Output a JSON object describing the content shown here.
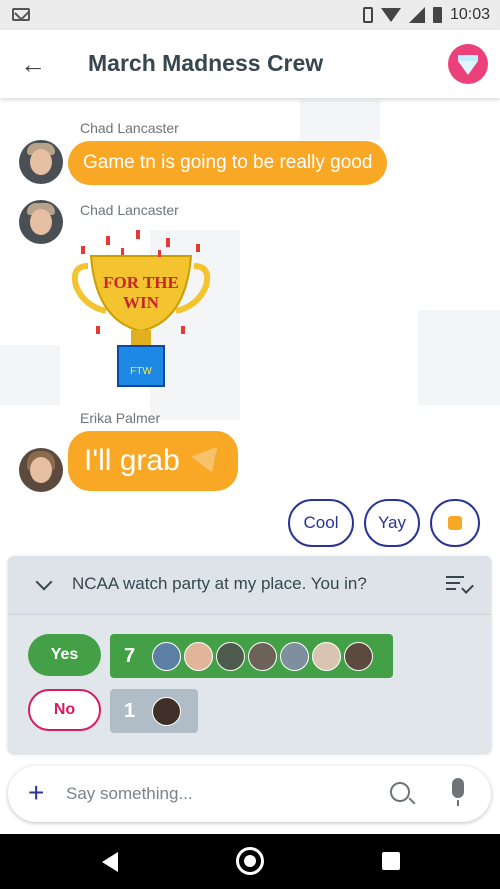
{
  "status_bar": {
    "time": "10:03"
  },
  "app_bar": {
    "title": "March Madness Crew"
  },
  "messages": [
    {
      "sender": "Chad Lancaster",
      "text": "Game tn is going to be really good"
    },
    {
      "sender": "Chad Lancaster",
      "sticker_text": "FOR THE WIN",
      "sticker_base_text": "FTW"
    },
    {
      "sender": "Erika Palmer",
      "text": "I'll grab"
    }
  ],
  "smart_replies": [
    "Cool",
    "Yay"
  ],
  "poll": {
    "question": "NCAA watch party at my place. You in?",
    "options": [
      {
        "label": "Yes",
        "count": "7"
      },
      {
        "label": "No",
        "count": "1"
      }
    ]
  },
  "compose": {
    "placeholder": "Say something..."
  },
  "colors": {
    "bubble": "#f9a825",
    "accent": "#283593",
    "yes": "#43a047",
    "no": "#d81b60",
    "avatar_gem": "#ec407a"
  },
  "icons": [
    "back-arrow-icon",
    "gem-icon",
    "chevron-down-icon",
    "checklist-icon",
    "plus-icon",
    "lens-icon",
    "mic-icon",
    "pizza-icon",
    "thumbs-up-icon"
  ]
}
